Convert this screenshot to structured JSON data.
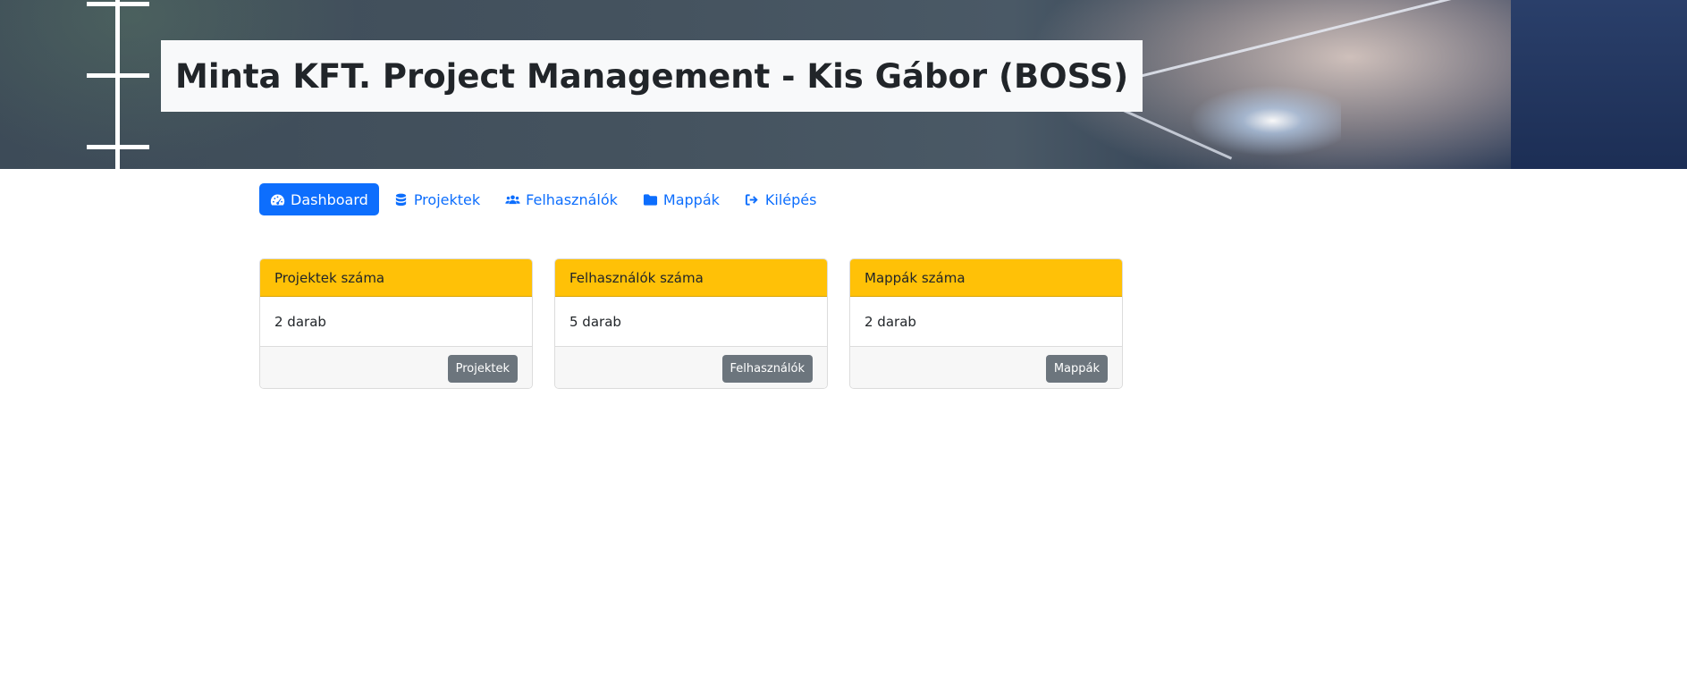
{
  "header": {
    "title": "Minta KFT. Project Management - Kis Gábor (BOSS)"
  },
  "nav": {
    "items": [
      {
        "label": "Dashboard",
        "icon": "gauge-icon",
        "active": true
      },
      {
        "label": "Projektek",
        "icon": "database-icon",
        "active": false
      },
      {
        "label": "Felhasználók",
        "icon": "users-icon",
        "active": false
      },
      {
        "label": "Mappák",
        "icon": "folder-icon",
        "active": false
      },
      {
        "label": "Kilépés",
        "icon": "sign-out-icon",
        "active": false
      }
    ]
  },
  "cards": [
    {
      "title": "Projektek száma",
      "value": "2 darab",
      "button": "Projektek"
    },
    {
      "title": "Felhasználók száma",
      "value": "5 darab",
      "button": "Felhasználók"
    },
    {
      "title": "Mappák száma",
      "value": "2 darab",
      "button": "Mappák"
    }
  ],
  "colors": {
    "primary": "#0d6efd",
    "card_header": "#ffc107",
    "button_secondary": "#6c757d"
  }
}
